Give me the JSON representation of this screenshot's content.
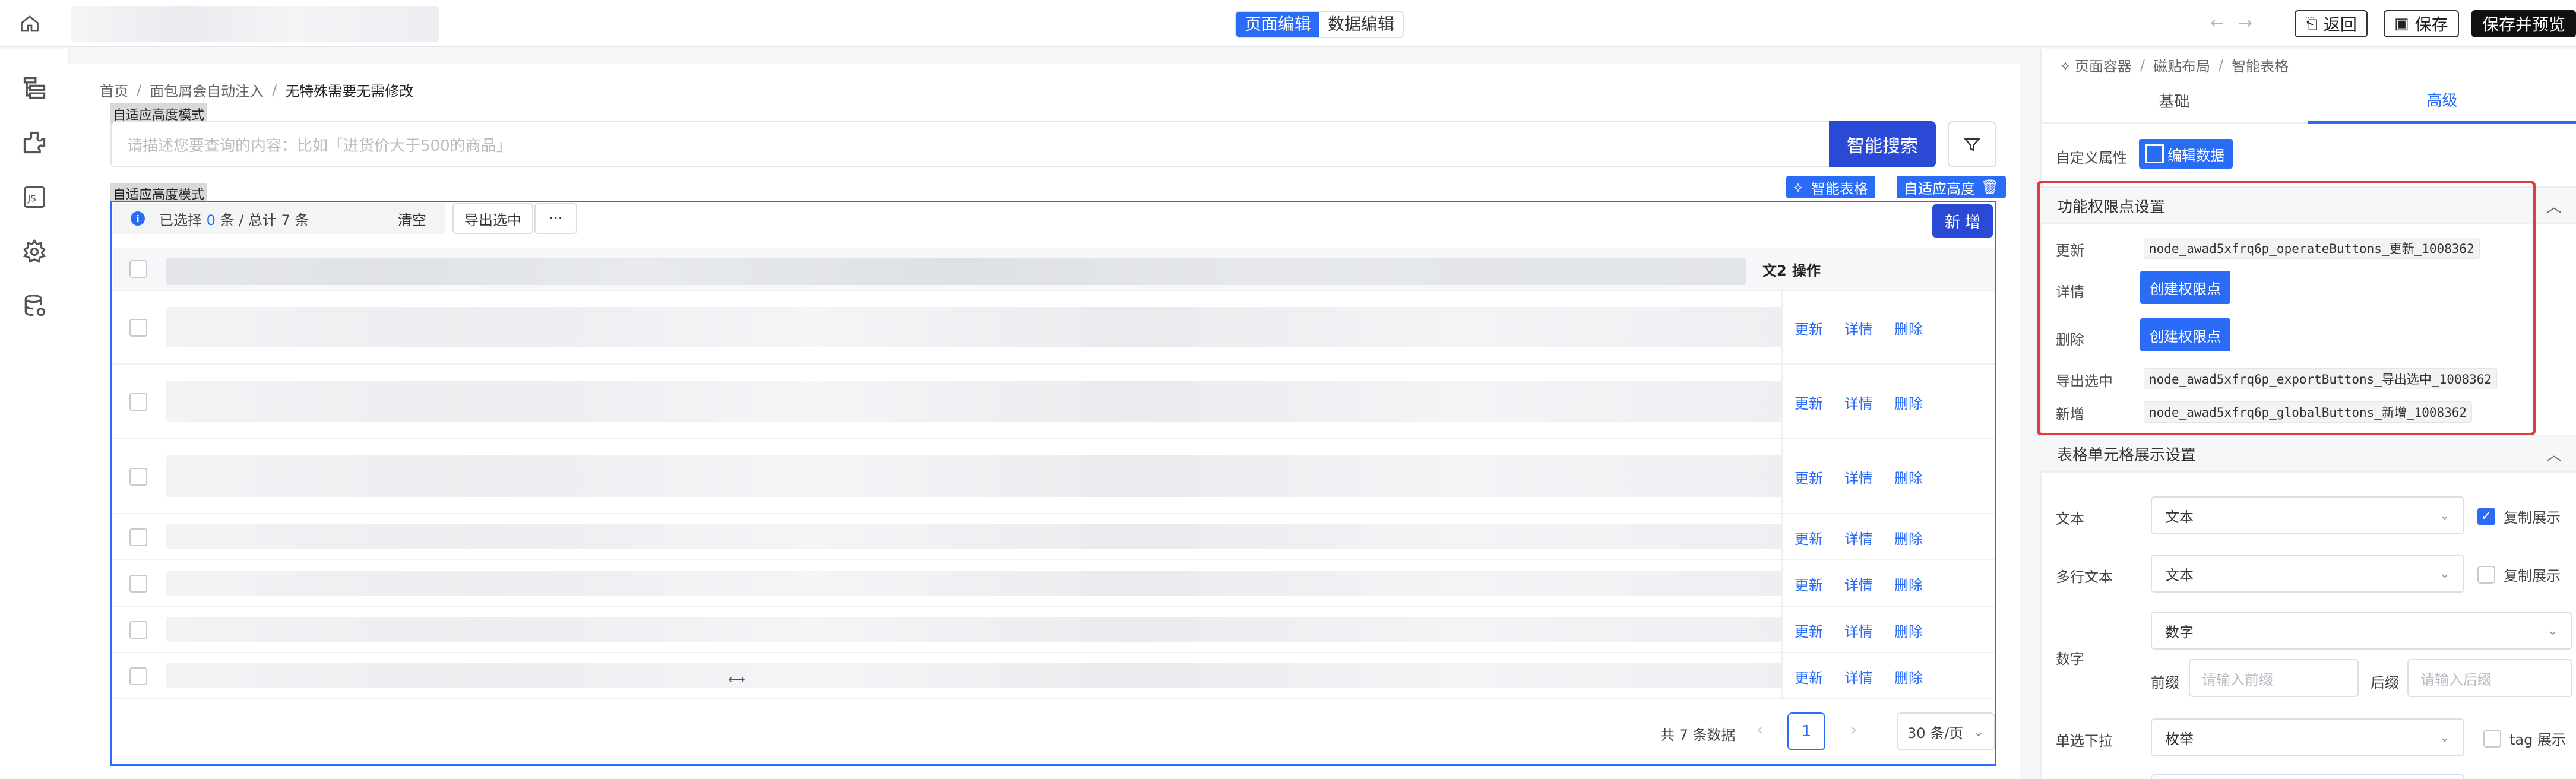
{
  "topbar": {
    "mode_tabs": [
      "页面编辑",
      "数据编辑"
    ],
    "undo": "←",
    "redo": "→",
    "back_label": "返回",
    "save_label": "保存",
    "save_preview_label": "保存并预览"
  },
  "canvas": {
    "breadcrumb": [
      "首页",
      "面包屑会自动注入",
      "无特殊需要无需修改"
    ],
    "adaptive_tag": "自适应高度模式",
    "search_placeholder": "请描述您要查询的内容：比如「进货价大于500的商品」",
    "smart_search_label": "智能搜索",
    "adaptive_tag_2": "自适应高度模式",
    "smart_table_chip": "智能表格",
    "adaptive_height_chip": "自适应高度",
    "selection": {
      "prefix": "已选择",
      "selected": "0",
      "suffix": "条 / 总计 7 条",
      "clear": "清空"
    },
    "export_selected": "导出选中",
    "more": "···",
    "add_new": "新 增",
    "col_wen": "文2",
    "col_ops": "操作",
    "row_ops": [
      "更新",
      "详情",
      "删除"
    ],
    "row_count": 7,
    "marker": "⟷",
    "pager": {
      "total": "共 7 条数据",
      "prev": "‹",
      "page": "1",
      "next": "›",
      "page_size": "30 条/页"
    }
  },
  "panel": {
    "breadcrumb": [
      "页面容器",
      "磁贴布局",
      "智能表格"
    ],
    "tabs": [
      "基础",
      "高级"
    ],
    "custom_attr_label": "自定义属性",
    "edit_data_label": "编辑数据",
    "perm_section": "功能权限点设置",
    "perms": [
      {
        "label": "更新",
        "code": "node_awad5xfrq6p_operateButtons_更新_1008362"
      },
      {
        "label": "详情",
        "button": "创建权限点"
      },
      {
        "label": "删除",
        "button": "创建权限点"
      },
      {
        "label": "导出选中",
        "code": "node_awad5xfrq6p_exportButtons_导出选中_1008362"
      },
      {
        "label": "新增",
        "code": "node_awad5xfrq6p_globalButtons_新增_1008362"
      }
    ],
    "cell_section": "表格单元格展示设置",
    "cells": {
      "text_label": "文本",
      "text_value": "文本",
      "text_copy": "复制展示",
      "multiline_label": "多行文本",
      "multiline_value": "文本",
      "multiline_copy": "复制展示",
      "number_label": "数字",
      "number_value": "数字",
      "prefix_label": "前缀",
      "prefix_placeholder": "请输入前缀",
      "suffix_label": "后缀",
      "suffix_placeholder": "请输入后缀",
      "single_select_label": "单选下拉",
      "single_select_value": "枚举",
      "tag_label": "tag 展示"
    }
  },
  "colors": {
    "primary": "#2a6cf6",
    "primary_dark": "#2a4ad6",
    "highlight": "#e23b3b"
  }
}
